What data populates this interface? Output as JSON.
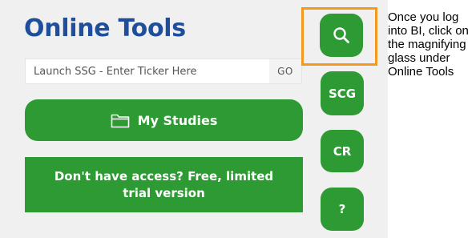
{
  "header": {
    "title": "Online Tools"
  },
  "search": {
    "placeholder": "Launch SSG - Enter Ticker Here",
    "value": "",
    "go_label": "GO"
  },
  "buttons": {
    "my_studies": "My Studies",
    "trial": "Don't have access? Free, limited trial version"
  },
  "sidebar": {
    "search_icon": "magnifying-glass-icon",
    "scg_label": "SCG",
    "cr_label": "CR",
    "help_label": "?"
  },
  "annotation": {
    "text": "Once you log into BI, click on the magnifying glass under Online Tools"
  },
  "colors": {
    "title": "#1f4f9c",
    "button_green": "#2e9a33",
    "highlight_orange": "#f39a1e",
    "panel_bg": "#f0f0f0"
  }
}
